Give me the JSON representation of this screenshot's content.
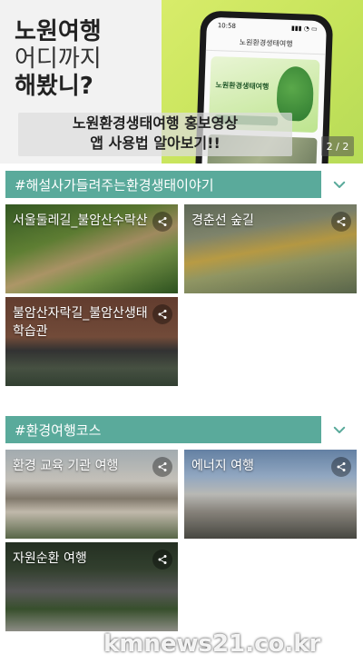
{
  "banner": {
    "title_line1": "노원여행",
    "title_line2": "어디까지",
    "title_line3": "해봤니?",
    "caption_line1": "노원환경생태여행 홍보영상",
    "caption_line2": "앱 사용법 알아보기!!",
    "pager": "2 / 2",
    "phone": {
      "time": "10:58",
      "app_title": "노원환경생태여행",
      "card_title": "노원환경생태여행"
    }
  },
  "sections": [
    {
      "title": "#해설사가들려주는환경생태이야기",
      "tiles": [
        {
          "label": "서울둘레길_불암산수락산"
        },
        {
          "label": "경춘선 숲길"
        },
        {
          "label": "불암산자락길_불암산생태학습관"
        }
      ]
    },
    {
      "title": "#환경여행코스",
      "tiles": [
        {
          "label": "환경 교육 기관 여행"
        },
        {
          "label": "에너지 여행"
        },
        {
          "label": "자원순환 여행"
        }
      ]
    }
  ],
  "watermark": "kmnews21.co.kr",
  "icons": {
    "share": "share-icon",
    "chevron": "chevron-down-icon"
  },
  "colors": {
    "section_bar": "#5aaa9b",
    "chevron": "#5aaa9b",
    "banner_green": "#c5e35a"
  }
}
